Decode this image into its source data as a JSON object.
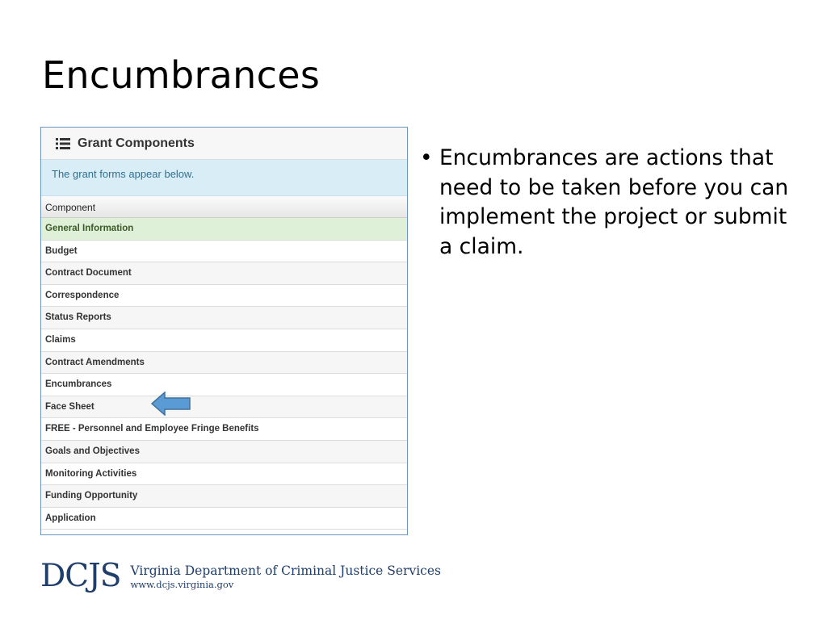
{
  "slide": {
    "title": "Encumbrances",
    "bullets": [
      "Encumbrances are actions that need to be taken before you can implement the project or submit a claim."
    ]
  },
  "panel": {
    "title": "Grant Components",
    "notice": "The grant forms appear below.",
    "column_header": "Component",
    "rows": [
      "General Information",
      "Budget",
      "Contract Document",
      "Correspondence",
      "Status Reports",
      "Claims",
      "Contract Amendments",
      "Encumbrances",
      "Face Sheet",
      "FREE - Personnel and Employee Fringe Benefits",
      "Goals and Objectives",
      "Monitoring Activities",
      "Funding Opportunity",
      "Application"
    ],
    "active_row": "General Information",
    "pointed_row": "Encumbrances",
    "icons": {
      "header": "list-icon",
      "pointer": "arrow-left-icon"
    }
  },
  "footer": {
    "logo": "DCJS",
    "agency": "Virginia Department of Criminal Justice Services",
    "url": "www.dcjs.virginia.gov"
  },
  "colors": {
    "panel_border": "#6d95be",
    "notice_bg": "#d9edf7",
    "active_row_bg": "#dff0d8",
    "arrow_fill": "#5b9bd5",
    "logo_color": "#1f3e6b"
  }
}
